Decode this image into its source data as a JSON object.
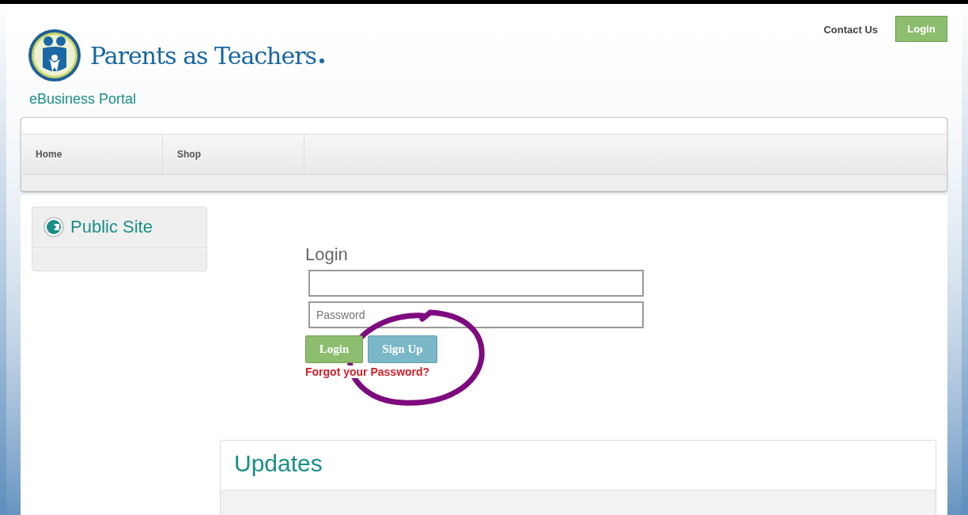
{
  "header": {
    "brand": "Parents as Teachers",
    "portal": "eBusiness Portal",
    "links": [
      {
        "label": "Contact Us",
        "kind": "link"
      },
      {
        "label": "Login",
        "kind": "button"
      }
    ]
  },
  "nav": {
    "items": [
      {
        "label": "Home"
      },
      {
        "label": "Shop"
      }
    ]
  },
  "sidebar": {
    "title": "Public Site"
  },
  "login_form": {
    "title": "Login",
    "password_field": {
      "placeholder": "Password"
    },
    "buttons": [
      {
        "label": "Login",
        "kind": "primary"
      },
      {
        "label": "Sign Up",
        "kind": "secondary"
      }
    ],
    "forgot_link": "Forgot your Password?"
  },
  "updates": {
    "title": "Updates"
  }
}
